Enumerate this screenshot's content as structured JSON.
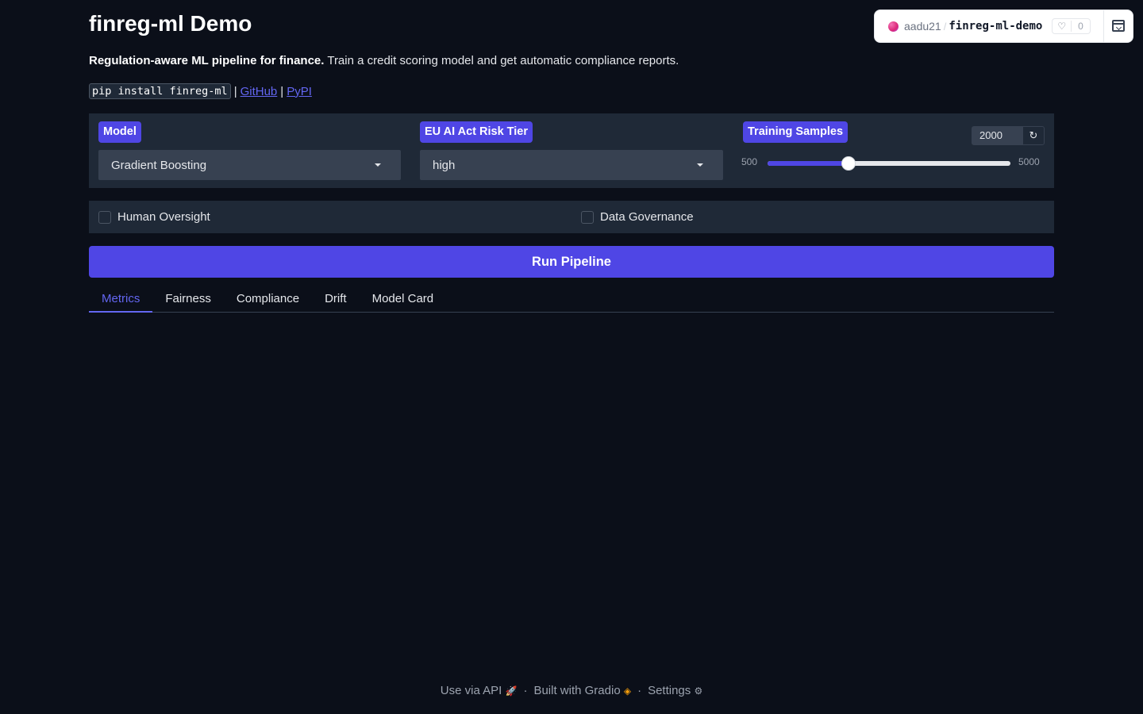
{
  "header": {
    "title": "finreg-ml Demo",
    "tagline_bold": "Regulation-aware ML pipeline for finance.",
    "tagline_rest": " Train a credit scoring model and get automatic compliance reports.",
    "install_code": "pip install finreg-ml",
    "separator": "|",
    "github_link": "GitHub",
    "pypi_link": "PyPI"
  },
  "hf_badge": {
    "user": "aadu21",
    "slash": "/",
    "repo": "finreg-ml-demo",
    "likes": "0",
    "heart_icon": "♡"
  },
  "controls": {
    "model_label": "Model",
    "model_value": "Gradient Boosting",
    "risk_label": "EU AI Act Risk Tier",
    "risk_value": "high",
    "samples_label": "Training Samples",
    "samples_value": "2000",
    "samples_min": "500",
    "samples_max": "5000",
    "samples_fraction": 0.3333,
    "reset_icon": "↻"
  },
  "checkboxes": {
    "human_oversight": "Human Oversight",
    "data_governance": "Data Governance"
  },
  "run_button": "Run Pipeline",
  "tabs": [
    "Metrics",
    "Fairness",
    "Compliance",
    "Drift",
    "Model Card"
  ],
  "footer": {
    "api": "Use via API",
    "built": "Built with Gradio",
    "settings": "Settings",
    "dot": "·"
  },
  "colors": {
    "background": "#0b0f19",
    "accent": "#4f46e5",
    "panel": "#1f2937"
  }
}
